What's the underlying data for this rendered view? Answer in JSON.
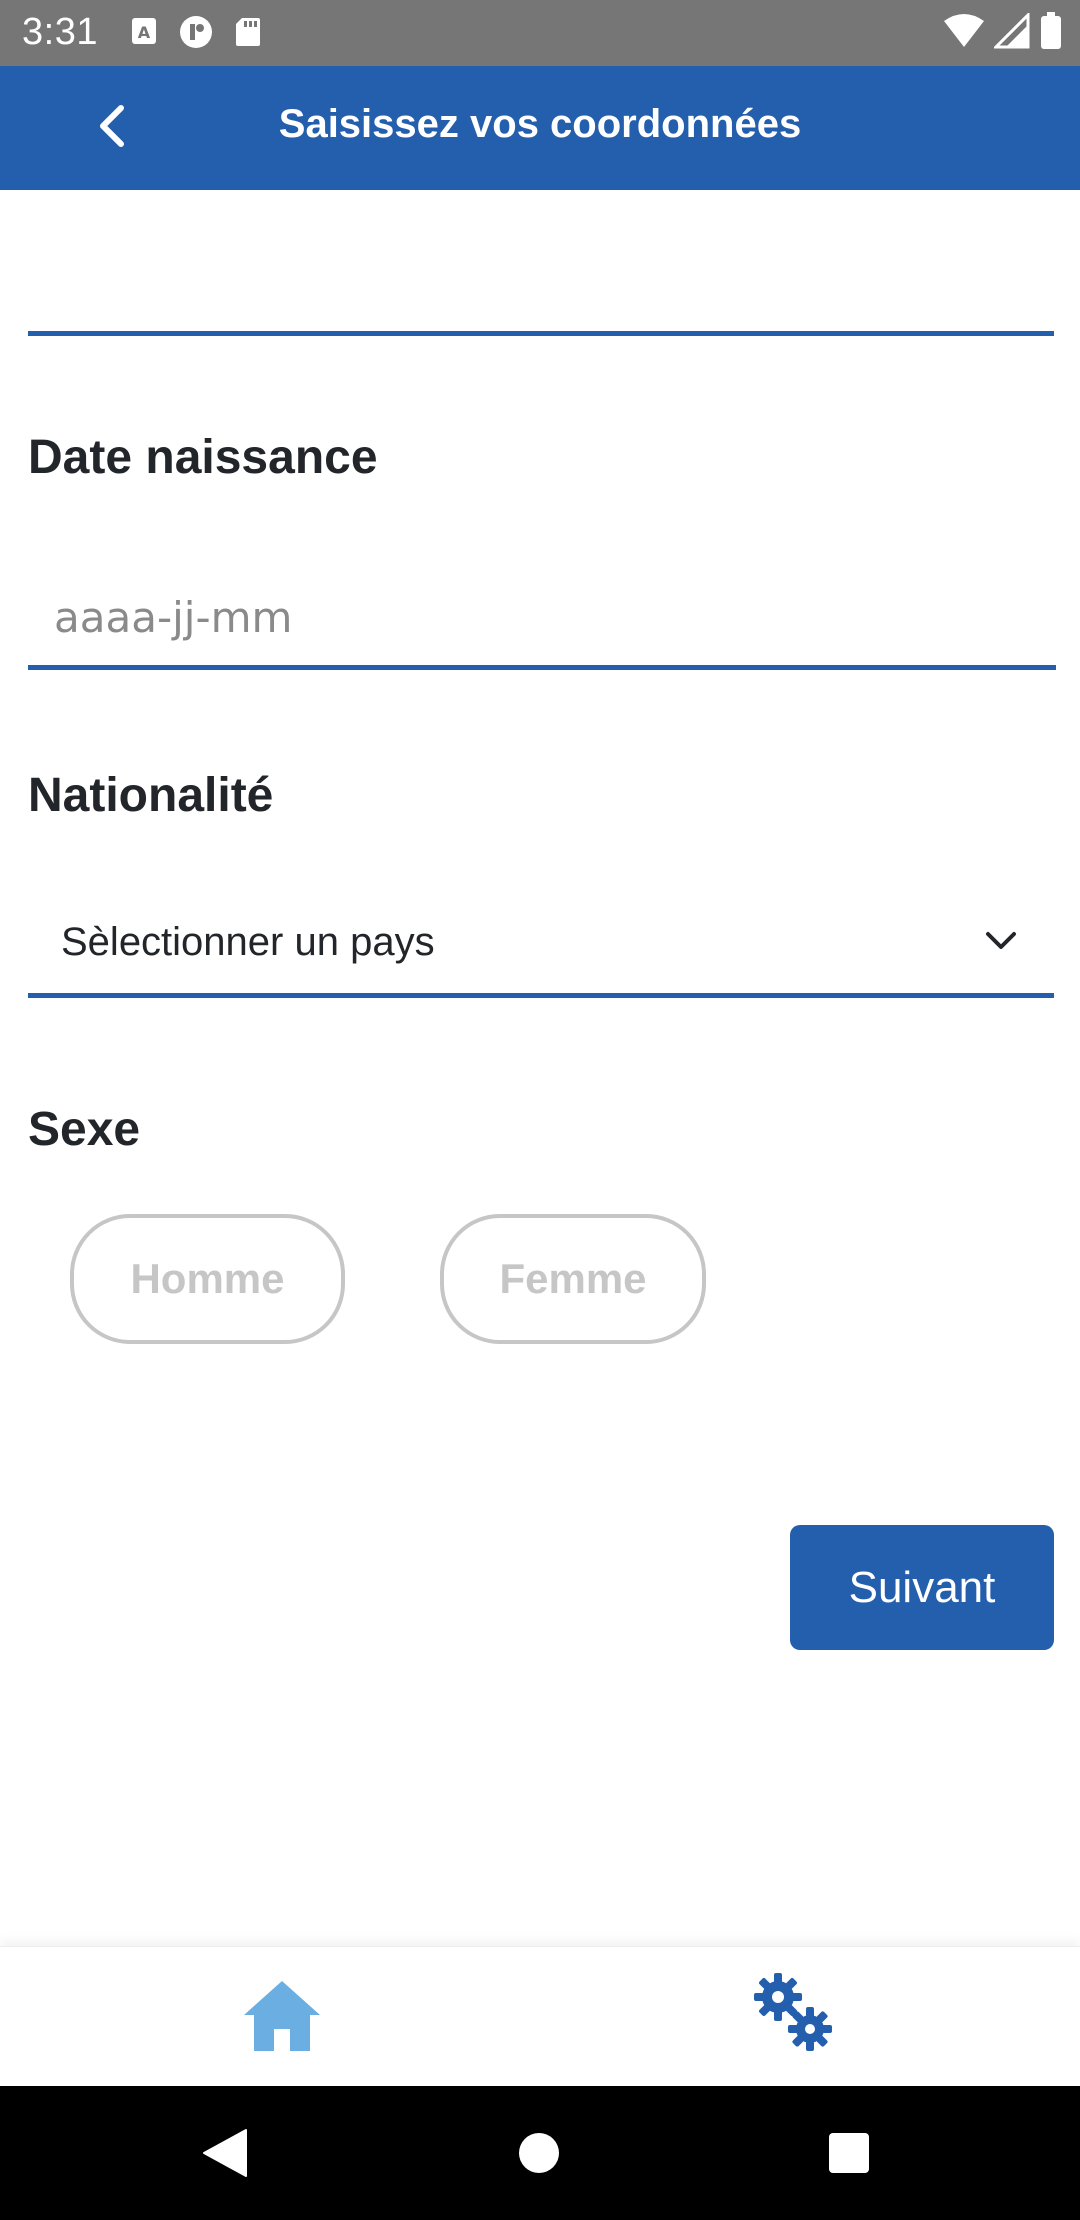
{
  "status_bar": {
    "time": "3:31",
    "left_icons": [
      "keyboard-a-icon",
      "media-icon",
      "sd-card-icon"
    ],
    "right_icons": [
      "wifi-icon",
      "signal-icon",
      "battery-icon"
    ]
  },
  "header": {
    "title": "Saisissez vos coordonnées",
    "back_icon": "chevron-left-icon"
  },
  "form": {
    "birth_date": {
      "label": "Date naissance",
      "placeholder": "aaaa-jj-mm",
      "value": ""
    },
    "nationality": {
      "label": "Nationalité",
      "selected": "Sèlectionner un pays"
    },
    "sex": {
      "label": "Sexe",
      "options": [
        "Homme",
        "Femme"
      ]
    },
    "next_label": "Suivant"
  },
  "bottom_nav": {
    "items": [
      "home-icon",
      "settings-gears-icon"
    ]
  },
  "colors": {
    "primary": "#245fae",
    "home_icon": "#6aaee2",
    "pill_border": "#c6c6c6"
  }
}
